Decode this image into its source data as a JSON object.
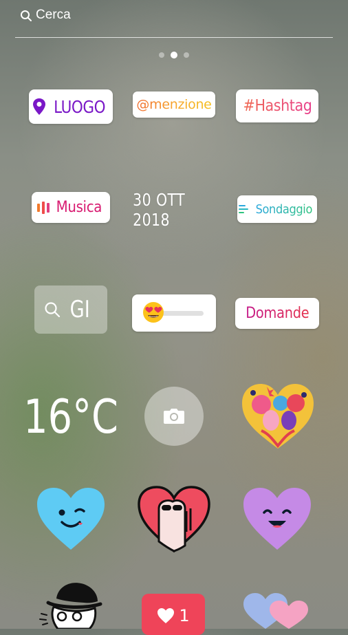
{
  "search": {
    "placeholder": "Cerca",
    "icon": "search-icon"
  },
  "pager": {
    "pages": 3,
    "active_index": 1
  },
  "stickers": {
    "location": {
      "label": "LUOGO",
      "icon": "location-pin-icon"
    },
    "mention": {
      "label": "@menzione"
    },
    "hashtag": {
      "label": "#Hashtag"
    },
    "music": {
      "label": "Musica",
      "icon": "music-bars-icon"
    },
    "date": {
      "label": "30 OTT 2018"
    },
    "poll": {
      "label": "Sondaggio",
      "icon": "poll-lines-icon"
    },
    "gif": {
      "label": "GI",
      "icon": "search-icon"
    },
    "emoji_slider": {
      "emoji": "heart-eyes-emoji",
      "icon": "slider-track"
    },
    "questions": {
      "label": "Domande"
    },
    "temperature": {
      "label": "16°C"
    },
    "camera": {
      "icon": "camera-icon"
    },
    "like_counter": {
      "count": "1",
      "icon": "heart-icon"
    }
  },
  "colors": {
    "location": "#7a18c7",
    "questions": "#c51b8a",
    "poll": "#2aa8dd",
    "like_badge": "#ef4459",
    "blue_heart": "#5ecbf4",
    "purple_heart": "#c58ae6",
    "red_heart": "#ee4c5f"
  }
}
